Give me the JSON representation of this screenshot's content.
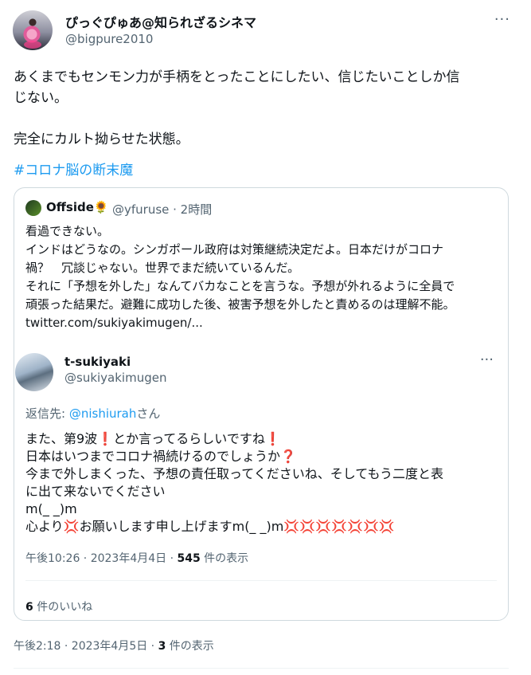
{
  "author": {
    "display_name": "ぴっぐぴゅあ@知られざるシネマ",
    "handle": "@bigpure2010",
    "more": "···"
  },
  "tweet": {
    "line1": "あくまでもセンモン力が手柄をとったことにしたい、信じたいことしか信",
    "line2": "じない。",
    "line3": "完全にカルト拗らせた状態。",
    "hashtag": "#コロナ脳の断末魔"
  },
  "quote": {
    "name": "Offside",
    "name_emoji": "🌻",
    "handle_time": "@yfuruse · 2時間",
    "lines": [
      "看過できない。",
      "インドはどうなの。シンガポール政府は対策継続決定だよ。日本だけがコロナ",
      "禍？　冗談じゃない。世界でまだ続いているんだ。",
      "それに「予想を外した」なんてバカなことを言うな。予想が外れるように全員で",
      "頑張った結果だ。避難に成功した後、被害予想を外したと責めるのは理解不能。",
      "twitter.com/sukiyakimugen/..."
    ]
  },
  "inner": {
    "name": "t-sukiyaki",
    "handle": "@sukiyakimugen",
    "more": "···",
    "reply_prefix": "返信先: ",
    "reply_link": "@nishiurah",
    "reply_suffix": "さん",
    "lines": [
      "また、第9波❗とか言ってるらしいですね❗",
      "日本はいつまでコロナ禍続けるのでしょうか❓",
      "今まで外しまくった、予想の責任取ってくださいね、そしてもう二度と表",
      "に出て来ないでください",
      "m(_ _)m",
      "心より💢お願いします申し上げますm(_ _)m💢💢💢💢💢💢💢"
    ],
    "time": "午後10:26 · 2023年4月4日 · ",
    "views_count": "545",
    "views_label": " 件の表示",
    "likes_count": "6",
    "likes_label": " 件のいいね"
  },
  "meta": {
    "time": "午後2:18 · 2023年4月5日 · ",
    "views_count": "3",
    "views_label": " 件の表示"
  }
}
